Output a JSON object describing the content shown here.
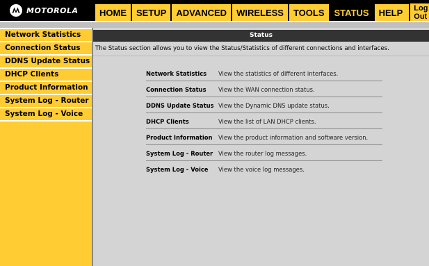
{
  "brand": {
    "name": "MOTOROLA",
    "logo_icon": "motorola-m-icon"
  },
  "nav": {
    "items": [
      {
        "label": "HOME"
      },
      {
        "label": "SETUP"
      },
      {
        "label": "ADVANCED"
      },
      {
        "label": "WIRELESS"
      },
      {
        "label": "TOOLS"
      },
      {
        "label": "STATUS"
      },
      {
        "label": "HELP"
      }
    ],
    "active": "STATUS",
    "logout_label": "Log Out"
  },
  "sidebar": {
    "items": [
      {
        "label": "Network Statistics"
      },
      {
        "label": "Connection Status"
      },
      {
        "label": "DDNS Update Status"
      },
      {
        "label": "DHCP Clients"
      },
      {
        "label": "Product Information"
      },
      {
        "label": "System Log - Router"
      },
      {
        "label": "System Log - Voice"
      }
    ]
  },
  "main": {
    "title": "Status",
    "intro": "The Status section allows you to view the Status/Statistics of different connections and interfaces.",
    "rows": [
      {
        "link": "Network Statistics",
        "desc": "View the statistics of different interfaces."
      },
      {
        "link": "Connection Status",
        "desc": "View the WAN connection status."
      },
      {
        "link": "DDNS Update Status",
        "desc": "View the Dynamic DNS update status."
      },
      {
        "link": "DHCP Clients",
        "desc": "View the list of LAN DHCP clients."
      },
      {
        "link": "Product Information",
        "desc": "View the product information and software version."
      },
      {
        "link": "System Log - Router",
        "desc": "View the router log messages."
      },
      {
        "link": "System Log - Voice",
        "desc": "View the voice log messages."
      }
    ]
  },
  "colors": {
    "accent": "#ffcc33",
    "topbar": "#000000",
    "panel": "#d4d4d4",
    "header": "#333333"
  }
}
